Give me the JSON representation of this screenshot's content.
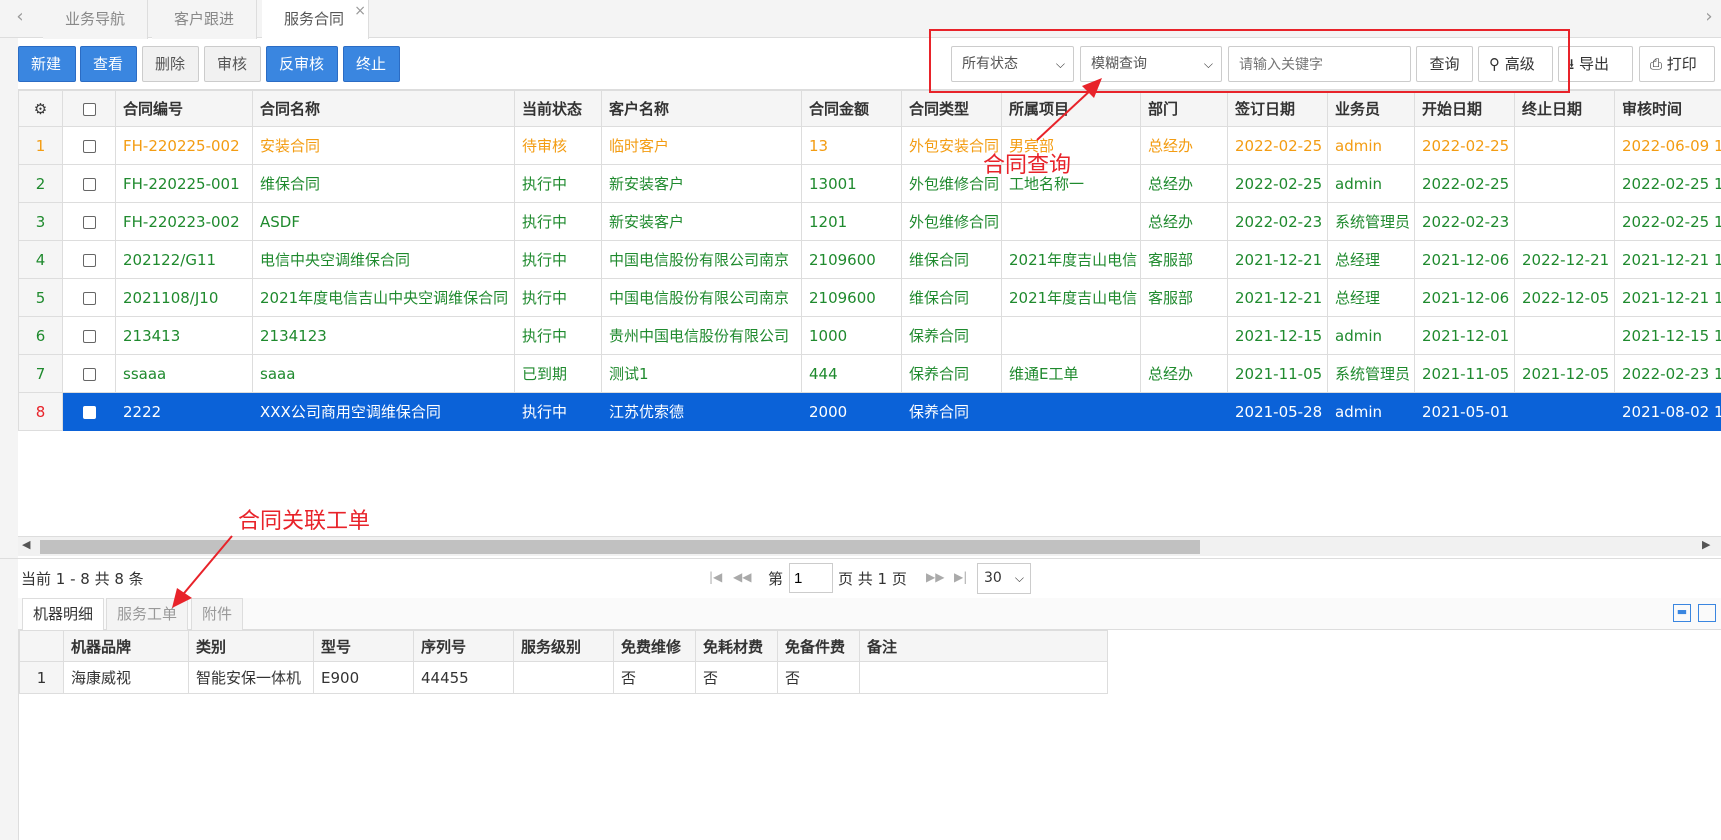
{
  "tabs": {
    "items": [
      "业务导航",
      "客户跟进",
      "服务合同"
    ],
    "close": "×",
    "left_arrow": "‹",
    "right_arrow": "›"
  },
  "toolbar": {
    "new": "新建",
    "view": "查看",
    "delete": "删除",
    "approve": "审核",
    "unapprove": "反审核",
    "terminate": "终止"
  },
  "search": {
    "status": "所有状态",
    "mode": "模糊查询",
    "placeholder": "请输入关键字",
    "query": "查询",
    "advanced": "高级",
    "export": "导出",
    "print": "打印"
  },
  "annotations": {
    "query": "合同查询",
    "linked": "合同关联工单"
  },
  "grid": {
    "headers": [
      "合同编号",
      "合同名称",
      "当前状态",
      "客户名称",
      "合同金额",
      "合同类型",
      "所属项目",
      "部门",
      "签订日期",
      "业务员",
      "开始日期",
      "终止日期",
      "审核时间"
    ],
    "rows": [
      [
        "1",
        "FH-220225-002",
        "安装合同",
        "待审核",
        "临时客户",
        "13",
        "外包安装合同",
        "男宾部",
        "总经办",
        "2022-02-25",
        "admin",
        "2022-02-25",
        "",
        "2022-06-09 1"
      ],
      [
        "2",
        "FH-220225-001",
        "维保合同",
        "执行中",
        "新安装客户",
        "13001",
        "外包维修合同",
        "工地名称一",
        "总经办",
        "2022-02-25",
        "admin",
        "2022-02-25",
        "",
        "2022-02-25 1"
      ],
      [
        "3",
        "FH-220223-002",
        "ASDF",
        "执行中",
        "新安装客户",
        "1201",
        "外包维修合同",
        "",
        "总经办",
        "2022-02-23",
        "系统管理员",
        "2022-02-23",
        "",
        "2022-02-25 1"
      ],
      [
        "4",
        "202122/G11",
        "电信中央空调维保合同",
        "执行中",
        "中国电信股份有限公司南京",
        "2109600",
        "维保合同",
        "2021年度吉山电信",
        "客服部",
        "2021-12-21",
        "总经理",
        "2021-12-06",
        "2022-12-21",
        "2021-12-21 1"
      ],
      [
        "5",
        "2021108/J10",
        "2021年度电信吉山中央空调维保合同",
        "执行中",
        "中国电信股份有限公司南京",
        "2109600",
        "维保合同",
        "2021年度吉山电信",
        "客服部",
        "2021-12-21",
        "总经理",
        "2021-12-06",
        "2022-12-05",
        "2021-12-21 1"
      ],
      [
        "6",
        "213413",
        "2134123",
        "执行中",
        "贵州中国电信股份有限公司",
        "1000",
        "保养合同",
        "",
        "",
        "2021-12-15",
        "admin",
        "2021-12-01",
        "",
        "2021-12-15 1"
      ],
      [
        "7",
        "ssaaa",
        "saaa",
        "已到期",
        "测试1",
        "444",
        "保养合同",
        "维通E工单",
        "总经办",
        "2021-11-05",
        "系统管理员",
        "2021-11-05",
        "2021-12-05",
        "2022-02-23 1"
      ],
      [
        "8",
        "2222",
        "XXX公司商用空调维保合同",
        "执行中",
        "江苏优索德",
        "2000",
        "保养合同",
        "",
        "",
        "2021-05-28",
        "admin",
        "2021-05-01",
        "",
        "2021-08-02 1"
      ]
    ]
  },
  "pager": {
    "summary": "当前 1 - 8 共 8 条",
    "page_prefix": "第",
    "page": "1",
    "page_suffix": "页 共 1 页",
    "page_size": "30"
  },
  "bottom": {
    "tabs": [
      "机器明细",
      "服务工单",
      "附件"
    ],
    "headers": [
      "机器品牌",
      "类别",
      "型号",
      "序列号",
      "服务级别",
      "免费维修",
      "免耗材费",
      "免备件费",
      "备注"
    ],
    "rows": [
      [
        "1",
        "海康威视",
        "智能安保一体机",
        "E900",
        "44455",
        "",
        "否",
        "否",
        "否",
        ""
      ]
    ]
  }
}
